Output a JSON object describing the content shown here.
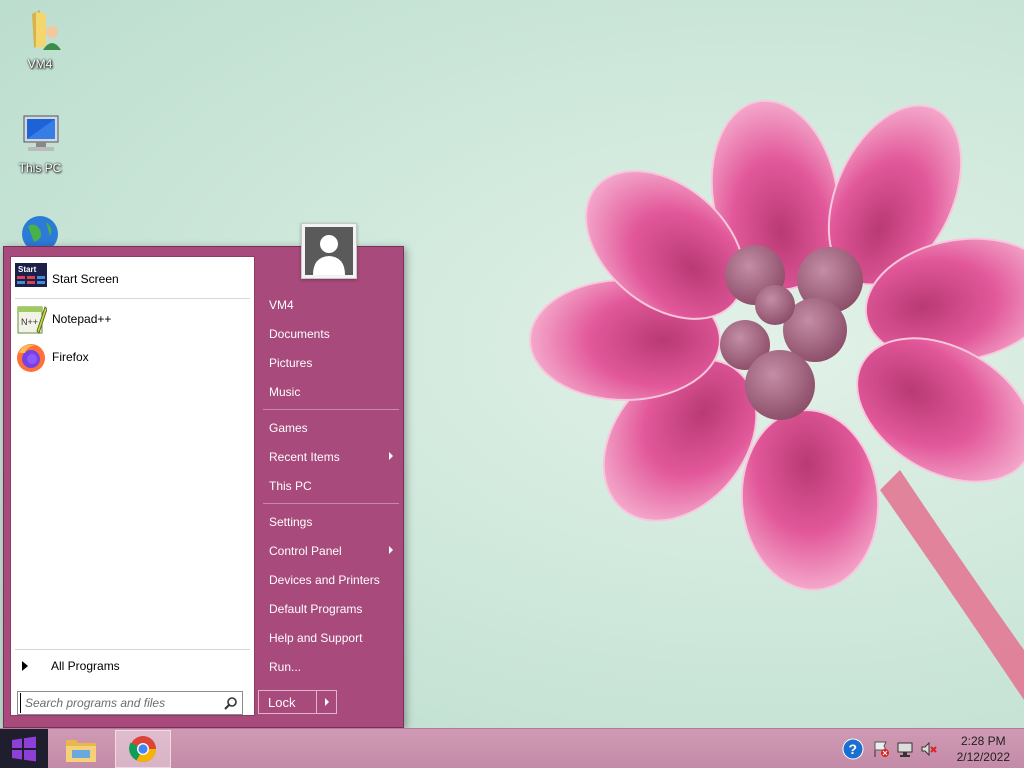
{
  "desktop": {
    "icons": [
      {
        "label": "VM4",
        "icon": "user-folder-icon"
      },
      {
        "label": "This PC",
        "icon": "computer-icon"
      },
      {
        "label": "",
        "icon": "network-globe-icon"
      }
    ]
  },
  "start_menu": {
    "pinned": [
      {
        "label": "Start Screen",
        "icon": "start-screen-icon"
      },
      {
        "label": "Notepad++",
        "icon": "notepadpp-icon"
      },
      {
        "label": "Firefox",
        "icon": "firefox-icon"
      }
    ],
    "all_programs": "All Programs",
    "search": {
      "placeholder": "Search programs and files",
      "value": ""
    },
    "start_screen_icon_text": "Start",
    "right_items": [
      {
        "label": "VM4"
      },
      {
        "label": "Documents"
      },
      {
        "label": "Pictures"
      },
      {
        "label": "Music"
      },
      {
        "label": "Games"
      },
      {
        "label": "Recent Items",
        "submenu": true
      },
      {
        "label": "This PC"
      },
      {
        "label": "Settings"
      },
      {
        "label": "Control Panel",
        "submenu": true
      },
      {
        "label": "Devices and Printers"
      },
      {
        "label": "Default Programs"
      },
      {
        "label": "Help and Support"
      },
      {
        "label": "Run..."
      }
    ],
    "lock_label": "Lock"
  },
  "taskbar": {
    "apps": [
      {
        "name": "File Explorer",
        "icon": "file-explorer-icon"
      },
      {
        "name": "Google Chrome",
        "icon": "chrome-icon",
        "active": true
      }
    ],
    "tray": [
      "help-icon",
      "action-center-flag-icon",
      "network-icon",
      "volume-muted-icon"
    ],
    "time": "2:28 PM",
    "date": "2/12/2022"
  },
  "colors": {
    "menu_accent": "#a84a7b",
    "taskbar": "#c991ad",
    "wallpaper_bg": "#cfe8dc",
    "flower": "#e0528f"
  }
}
